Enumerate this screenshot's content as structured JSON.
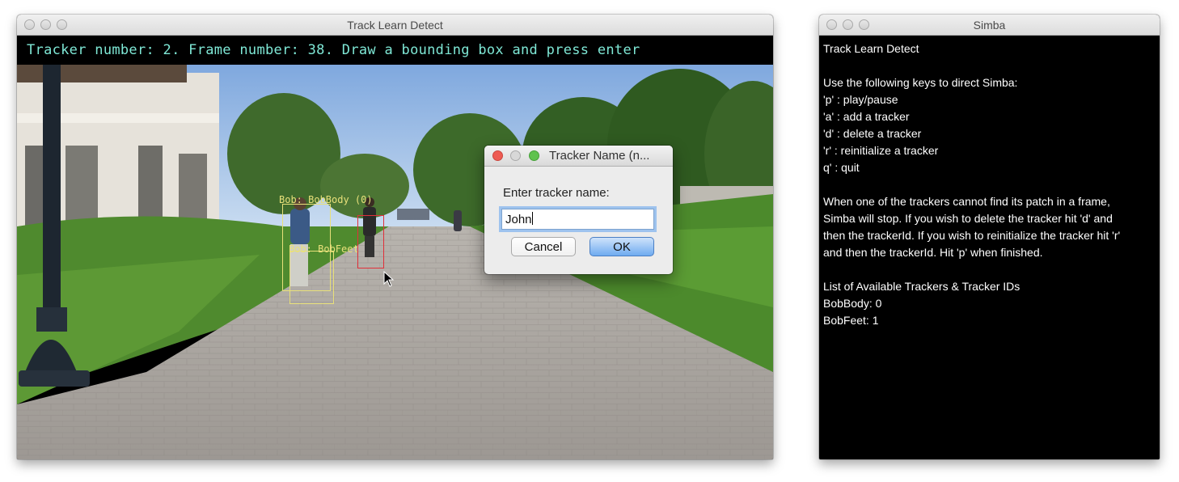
{
  "tld_window": {
    "title": "Track Learn Detect",
    "status_text": "Tracker number: 2. Frame number: 38. Draw a bounding box and press enter",
    "trackers": [
      {
        "label": "Bob: BobBody (0)"
      },
      {
        "label": "Bob: BobFeet"
      }
    ]
  },
  "dialog": {
    "title": "Tracker Name (n...",
    "prompt": "Enter tracker name:",
    "input_value": "John",
    "cancel_label": "Cancel",
    "ok_label": "OK"
  },
  "simba_window": {
    "title": "Simba",
    "heading": "Track Learn Detect",
    "keys_intro": "Use the following keys to direct Simba:",
    "keys": [
      "'p' : play/pause",
      "'a' : add a tracker",
      "'d' : delete a tracker",
      "'r' : reinitialize a tracker",
      "q' : quit"
    ],
    "help_lines": [
      "When one of the trackers cannot find its patch in a frame,",
      "Simba will stop. If you wish to delete the tracker hit 'd' and",
      "then the trackerId. If you wish to reinitialize the tracker hit 'r'",
      "and then the trackerId. Hit 'p' when finished."
    ],
    "list_title": "List of Available Trackers & Tracker IDs",
    "tracker_list": [
      "BobBody: 0",
      "BobFeet: 1"
    ]
  },
  "colors": {
    "status_text": "#7fe8d6",
    "tracker_box": "#e8e07a",
    "selection_box": "#e0303a",
    "close_button": "#ee5b52",
    "zoom_button": "#5fc24e"
  }
}
